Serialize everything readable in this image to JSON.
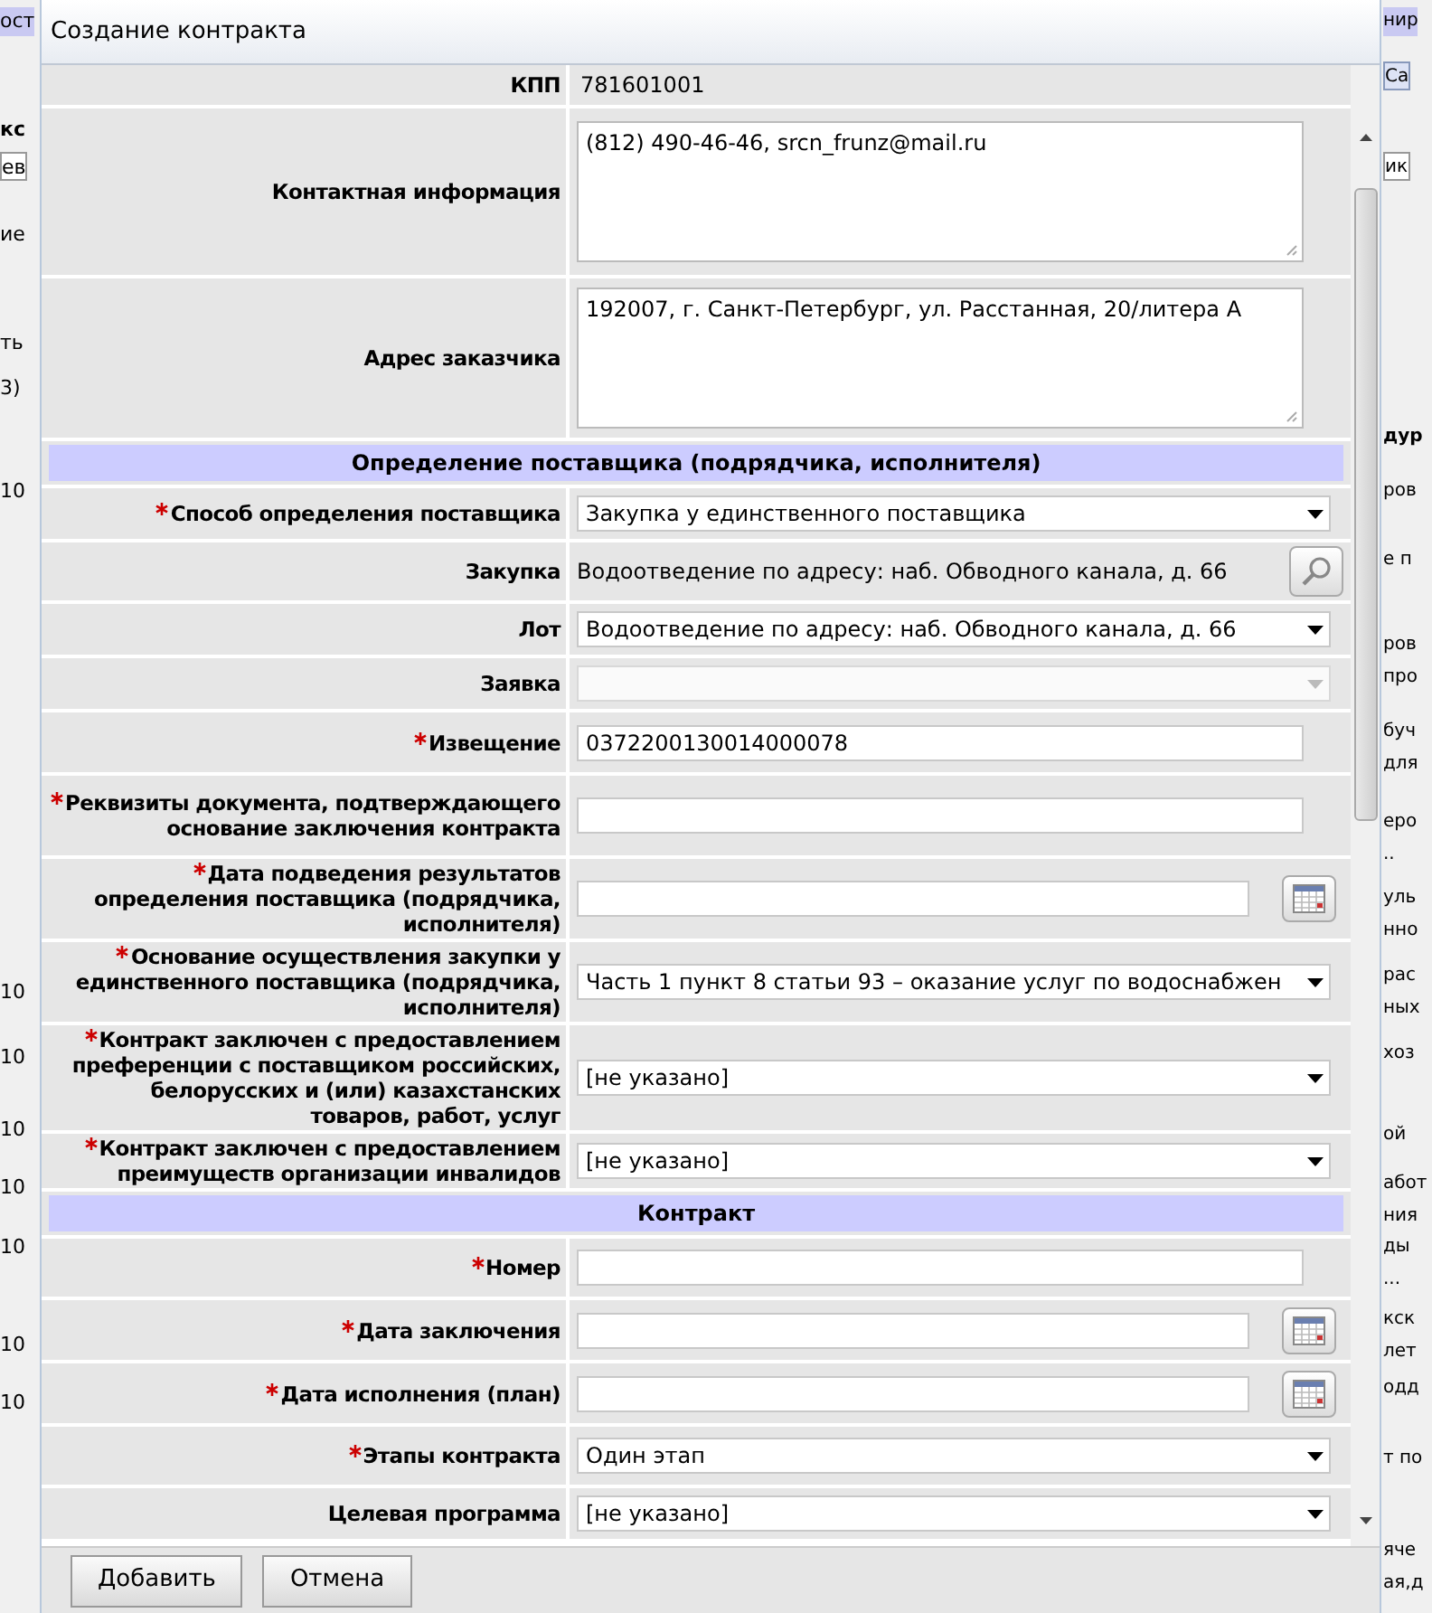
{
  "window": {
    "title": "Создание контракта"
  },
  "background_left": [
    {
      "text": "ост",
      "kind": "band"
    },
    {
      "text": "кс",
      "kind": "bold"
    },
    {
      "text": "ев",
      "kind": "field"
    },
    {
      "text": "ие",
      "kind": "plain"
    },
    {
      "text": "ть",
      "kind": "plain"
    },
    {
      "text": "3)",
      "kind": "plain"
    },
    {
      "text": "10",
      "kind": "plain"
    },
    {
      "text": "10",
      "kind": "plain"
    },
    {
      "text": "10",
      "kind": "plain"
    },
    {
      "text": "10",
      "kind": "plain"
    },
    {
      "text": "10",
      "kind": "plain"
    },
    {
      "text": "10",
      "kind": "plain"
    },
    {
      "text": "10",
      "kind": "plain"
    },
    {
      "text": "10",
      "kind": "plain"
    }
  ],
  "background_right": [
    {
      "text": "нир",
      "kind": "band"
    },
    {
      "text": "Са",
      "kind": "tab"
    },
    {
      "text": "ик",
      "kind": "field"
    },
    {
      "text": "дур",
      "kind": "bold"
    },
    {
      "text": "ров",
      "kind": "plain"
    },
    {
      "text": "е п",
      "kind": "plain"
    },
    {
      "text": "ров",
      "kind": "plain"
    },
    {
      "text": "про",
      "kind": "plain"
    },
    {
      "text": "буч",
      "kind": "plain"
    },
    {
      "text": "для",
      "kind": "plain"
    },
    {
      "text": "еро",
      "kind": "plain"
    },
    {
      "text": "..",
      "kind": "plain"
    },
    {
      "text": "уль",
      "kind": "plain"
    },
    {
      "text": "нно",
      "kind": "plain"
    },
    {
      "text": "рас",
      "kind": "plain"
    },
    {
      "text": "ных",
      "kind": "plain"
    },
    {
      "text": "хоз",
      "kind": "plain"
    },
    {
      "text": "ой",
      "kind": "plain"
    },
    {
      "text": "абот",
      "kind": "plain"
    },
    {
      "text": "ния",
      "kind": "plain"
    },
    {
      "text": "ды",
      "kind": "plain"
    },
    {
      "text": "...",
      "kind": "plain"
    },
    {
      "text": "кск",
      "kind": "plain"
    },
    {
      "text": "лет",
      "kind": "plain"
    },
    {
      "text": "одд",
      "kind": "plain"
    },
    {
      "text": "т по",
      "kind": "plain"
    },
    {
      "text": "яче",
      "kind": "plain"
    },
    {
      "text": "ая,д",
      "kind": "plain"
    }
  ],
  "form": {
    "rows": [
      {
        "kind": "static",
        "label": "КПП",
        "required": false,
        "value": "781601001"
      },
      {
        "kind": "textarea",
        "label": "Контактная информация",
        "required": false,
        "value": "(812) 490-46-46, srcn_frunz@mail.ru"
      },
      {
        "kind": "textarea",
        "label": "Адрес заказчика",
        "required": false,
        "value": "192007, г. Санкт-Петербург, ул. Расстанная, 20/литера А"
      },
      {
        "kind": "section",
        "label": "Определение поставщика (подрядчика, исполнителя)"
      },
      {
        "kind": "select",
        "label": "Способ определения поставщика",
        "required": true,
        "value": "Закупка у единственного поставщика"
      },
      {
        "kind": "lookup",
        "label": "Закупка",
        "required": false,
        "value": "Водоотведение по адресу: наб. Обводного канала, д. 66"
      },
      {
        "kind": "select",
        "label": "Лот",
        "required": false,
        "value": "Водоотведение по адресу: наб. Обводного канала, д. 66"
      },
      {
        "kind": "select",
        "label": "Заявка",
        "required": false,
        "disabled": true
      },
      {
        "kind": "input",
        "label": "Извещение",
        "required": true,
        "value": "0372200130014000078"
      },
      {
        "kind": "input",
        "label": "Реквизиты документа, подтверждающего основание заключения контракта",
        "required": true
      },
      {
        "kind": "date",
        "label": "Дата подведения результатов определения поставщика (подрядчика, исполнителя)",
        "required": true
      },
      {
        "kind": "select",
        "label": "Основание осуществления закупки у единственного поставщика (подрядчика, исполнителя)",
        "required": true,
        "value": "Часть 1 пункт 8 статьи 93 – оказание услуг по водоснабжен"
      },
      {
        "kind": "select",
        "label": "Контракт заключен с предоставлением преференции с поставщиком российских, белорусских и (или) казахстанских товаров, работ, услуг",
        "required": true,
        "value": "[не указано]"
      },
      {
        "kind": "select",
        "label": "Контракт заключен с предоставлением преимуществ организации инвалидов",
        "required": true,
        "value": "[не указано]"
      },
      {
        "kind": "section",
        "label": "Контракт"
      },
      {
        "kind": "input",
        "label": "Номер",
        "required": true
      },
      {
        "kind": "date",
        "label": "Дата заключения",
        "required": true
      },
      {
        "kind": "date",
        "label": "Дата исполнения (план)",
        "required": true
      },
      {
        "kind": "select",
        "label": "Этапы контракта",
        "required": true,
        "value": "Один этап"
      },
      {
        "kind": "select",
        "label": "Целевая программа",
        "required": false,
        "value": "[не указано]"
      }
    ]
  },
  "buttons": [
    {
      "label": "Добавить"
    },
    {
      "label": "Отмена"
    }
  ]
}
